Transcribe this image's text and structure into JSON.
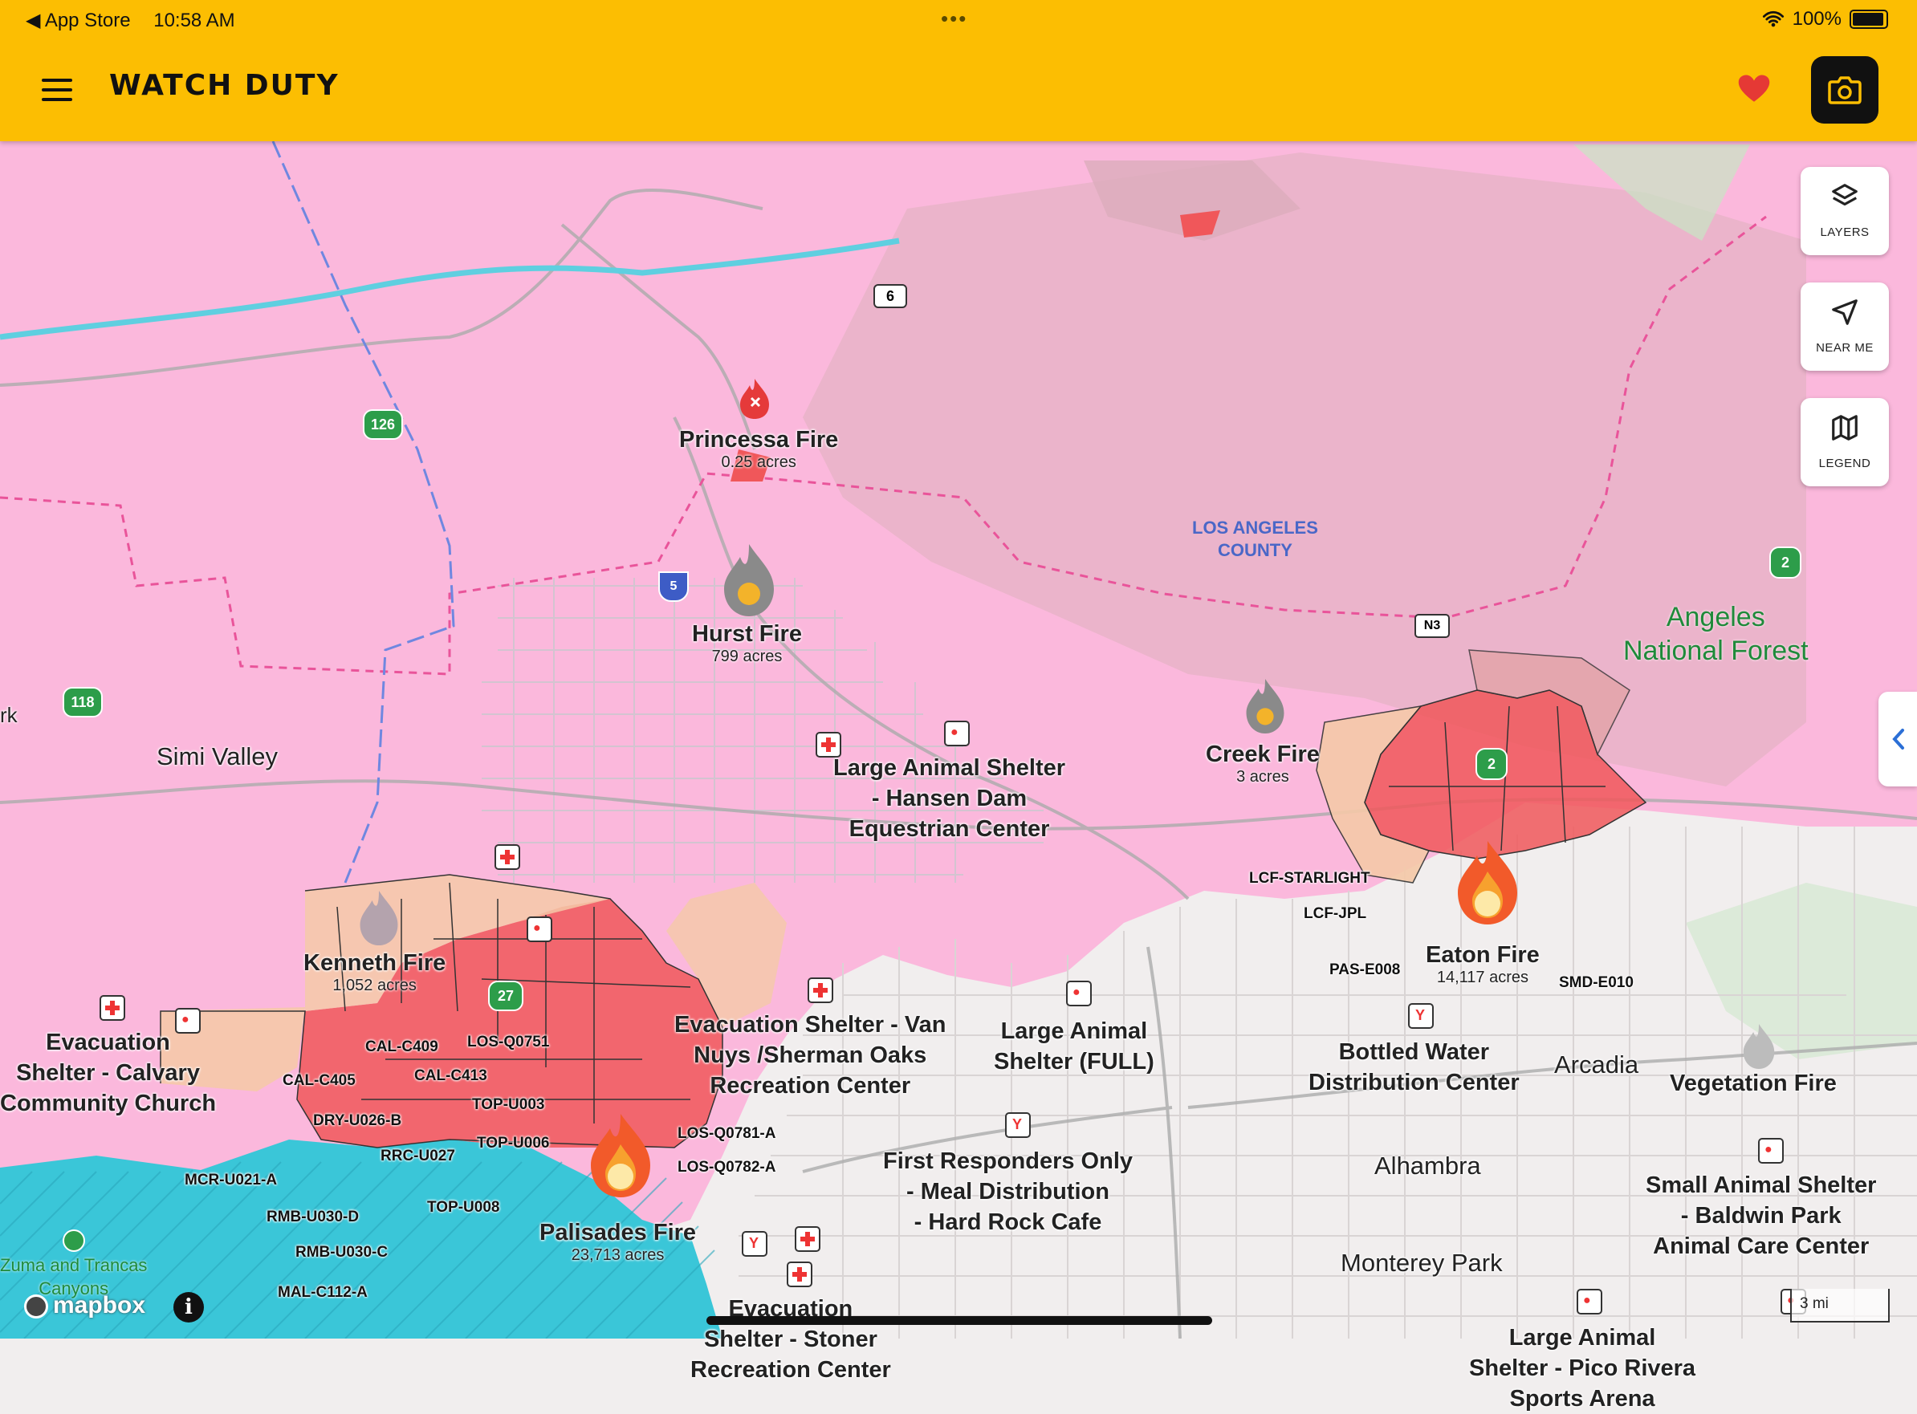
{
  "status_bar": {
    "back_app": "App Store",
    "time": "10:58 AM",
    "battery": "100%"
  },
  "header": {
    "title": "WATCH DUTY"
  },
  "controls": [
    {
      "label": "LAYERS",
      "icon": "layers-icon"
    },
    {
      "label": "NEAR ME",
      "icon": "navigation-arrow-icon"
    },
    {
      "label": "LEGEND",
      "icon": "map-icon"
    }
  ],
  "fires": [
    {
      "name": "Princessa Fire",
      "acres": "0.25 acres"
    },
    {
      "name": "Hurst Fire",
      "acres": "799 acres"
    },
    {
      "name": "Creek Fire",
      "acres": "3 acres"
    },
    {
      "name": "Kenneth Fire",
      "acres": "1,052 acres"
    },
    {
      "name": "Eaton Fire",
      "acres": "14,117 acres"
    },
    {
      "name": "Palisades Fire",
      "acres": "23,713 acres"
    },
    {
      "name": "Vegetation Fire",
      "acres": ""
    }
  ],
  "pois": [
    {
      "lines": [
        "Large Animal Shelter",
        "- Hansen Dam",
        "Equestrian Center"
      ]
    },
    {
      "lines": [
        "Evacuation",
        "Shelter - Calvary",
        "Community Church"
      ]
    },
    {
      "lines": [
        "Evacuation Shelter - Van",
        "Nuys /Sherman Oaks",
        "Recreation Center"
      ]
    },
    {
      "lines": [
        "Large Animal",
        "Shelter (FULL)"
      ]
    },
    {
      "lines": [
        "Bottled Water",
        "Distribution Center"
      ]
    },
    {
      "lines": [
        "First Responders Only",
        "- Meal Distribution",
        "- Hard Rock Cafe"
      ]
    },
    {
      "lines": [
        "Evacuation",
        "Shelter - Stoner",
        "Recreation Center"
      ]
    },
    {
      "lines": [
        "Small Animal Shelter",
        "- Baldwin Park",
        "Animal Care Center"
      ]
    },
    {
      "lines": [
        "Large Animal",
        "Shelter - Pico Rivera",
        "Sports Arena"
      ]
    }
  ],
  "cities": [
    "Simi Valley",
    "Arcadia",
    "Alhambra",
    "Monterey Park",
    "rk"
  ],
  "parks": [
    {
      "lines": [
        "Angeles",
        "National Forest"
      ]
    },
    {
      "lines": [
        "Zuma and Trancas",
        "Canyons"
      ]
    }
  ],
  "county": [
    "LOS ANGELES",
    "COUNTY"
  ],
  "zones": [
    "CAL-C409",
    "LOS-Q0751",
    "CAL-C405",
    "CAL-C413",
    "TOP-U003",
    "DRY-U026-B",
    "TOP-U006",
    "RRC-U027",
    "LOS-Q0781-A",
    "LOS-Q0782-A",
    "MCR-U021-A",
    "TOP-U008",
    "RMB-U030-D",
    "RMB-U030-C",
    "MAL-C112-A",
    "LCF-STARLIGHT",
    "LCF-JPL",
    "PAS-E008",
    "SMD-E010"
  ],
  "highways": [
    "6",
    "126",
    "5",
    "118",
    "27",
    "2",
    "2",
    "N3"
  ],
  "map_footer": {
    "brand": "mapbox",
    "scale": "3 mi",
    "info": "i"
  },
  "colors": {
    "header": "#fcbe02",
    "evac_zone": "#fbb8dc",
    "fire_perimeter": "#f0575a",
    "ocean": "#3ac6d8"
  }
}
